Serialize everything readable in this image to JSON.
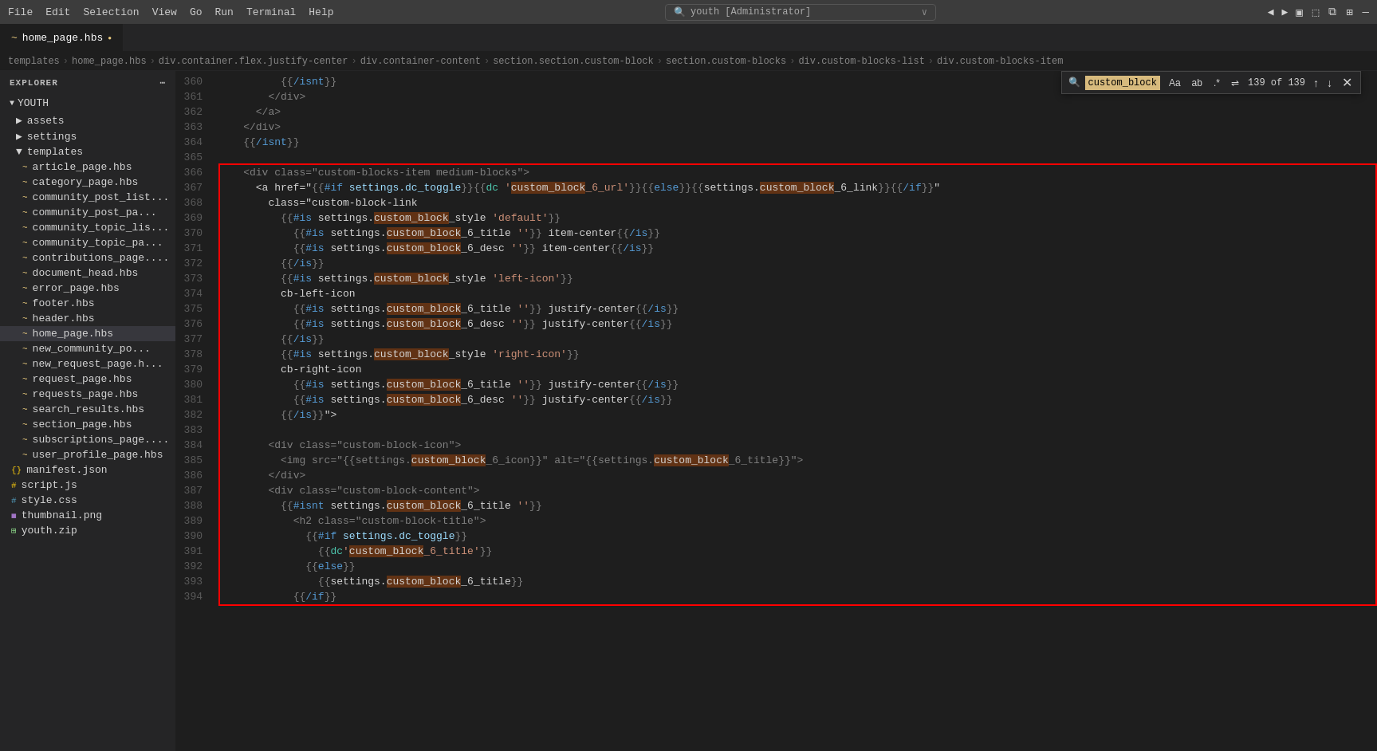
{
  "titlebar": {
    "menu": [
      "File",
      "Edit",
      "Selection",
      "View",
      "Go",
      "Run",
      "Terminal",
      "Help"
    ],
    "search_placeholder": "youth [Administrator]",
    "nav_back": "◀",
    "nav_fwd": "▶"
  },
  "tab": {
    "icon": "~",
    "filename": "home_page.hbs",
    "modified": true,
    "dot": "●"
  },
  "breadcrumb": {
    "items": [
      "templates",
      "home_page.hbs",
      "div.container.flex.justify-center",
      "div.container-content",
      "section.section.custom-block",
      "section.custom-blocks",
      "div.custom-blocks-list",
      "div.custom-blocks-item"
    ]
  },
  "sidebar": {
    "header": "EXPLORER",
    "root": "YOUTH",
    "sections": [
      {
        "label": "assets",
        "expanded": false
      },
      {
        "label": "settings",
        "expanded": false
      },
      {
        "label": "templates",
        "expanded": true
      }
    ],
    "files": [
      {
        "name": "article_page.hbs",
        "type": "hbs"
      },
      {
        "name": "category_page.hbs",
        "type": "hbs"
      },
      {
        "name": "community_post_list...",
        "type": "hbs"
      },
      {
        "name": "community_post_pa...",
        "type": "hbs"
      },
      {
        "name": "community_topic_lis...",
        "type": "hbs"
      },
      {
        "name": "community_topic_pa...",
        "type": "hbs"
      },
      {
        "name": "contributions_page....",
        "type": "hbs"
      },
      {
        "name": "document_head.hbs",
        "type": "hbs"
      },
      {
        "name": "error_page.hbs",
        "type": "hbs"
      },
      {
        "name": "footer.hbs",
        "type": "hbs"
      },
      {
        "name": "header.hbs",
        "type": "hbs"
      },
      {
        "name": "home_page.hbs",
        "type": "hbs",
        "active": true
      },
      {
        "name": "new_community_po...",
        "type": "hbs"
      },
      {
        "name": "new_request_page.h...",
        "type": "hbs"
      },
      {
        "name": "request_page.hbs",
        "type": "hbs"
      },
      {
        "name": "requests_page.hbs",
        "type": "hbs"
      },
      {
        "name": "search_results.hbs",
        "type": "hbs"
      },
      {
        "name": "section_page.hbs",
        "type": "hbs"
      },
      {
        "name": "subscriptions_page....",
        "type": "hbs"
      },
      {
        "name": "user_profile_page.hbs",
        "type": "hbs"
      }
    ],
    "root_files": [
      {
        "name": "manifest.json",
        "type": "json"
      },
      {
        "name": "script.js",
        "type": "js"
      },
      {
        "name": "style.css",
        "type": "css"
      },
      {
        "name": "thumbnail.png",
        "type": "png"
      },
      {
        "name": "youth.zip",
        "type": "zip"
      }
    ]
  },
  "find_widget": {
    "query": "custom_block",
    "options": [
      "Aa",
      "ab",
      ".*"
    ],
    "count": "139 of 139",
    "highlighted_text": "custom_block"
  },
  "code_lines": [
    {
      "num": 360,
      "content": "          {{/isnt}}"
    },
    {
      "num": 361,
      "content": "        </div>"
    },
    {
      "num": 362,
      "content": "      </a>"
    },
    {
      "num": 363,
      "content": "    </div>"
    },
    {
      "num": 364,
      "content": "    {{/isnt}}"
    },
    {
      "num": 365,
      "content": ""
    },
    {
      "num": 366,
      "content": "    <div class=\"custom-blocks-item medium-blocks\">",
      "highlight_start": true
    },
    {
      "num": 367,
      "content": "      <a href=\"{{#if settings.dc_toggle}}{{dc 'custom_block_6_url'}}{{else}}{{settings.custom_block_6_link}}{{/if}}\""
    },
    {
      "num": 368,
      "content": "        class=\"custom-block-link"
    },
    {
      "num": 369,
      "content": "          {{#is settings.custom_block_style 'default'}}"
    },
    {
      "num": 370,
      "content": "            {{#is settings.custom_block_6_title ''}} item-center{{/is}}"
    },
    {
      "num": 371,
      "content": "            {{#is settings.custom_block_6_desc ''}} item-center{{/is}}"
    },
    {
      "num": 372,
      "content": "          {{/is}}"
    },
    {
      "num": 373,
      "content": "          {{#is settings.custom_block_style 'left-icon'}}"
    },
    {
      "num": 374,
      "content": "          cb-left-icon"
    },
    {
      "num": 375,
      "content": "            {{#is settings.custom_block_6_title ''}} justify-center{{/is}}"
    },
    {
      "num": 376,
      "content": "            {{#is settings.custom_block_6_desc ''}} justify-center{{/is}}"
    },
    {
      "num": 377,
      "content": "          {{/is}}"
    },
    {
      "num": 378,
      "content": "          {{#is settings.custom_block_style 'right-icon'}}"
    },
    {
      "num": 379,
      "content": "          cb-right-icon"
    },
    {
      "num": 380,
      "content": "            {{#is settings.custom_block_6_title ''}} justify-center{{/is}}"
    },
    {
      "num": 381,
      "content": "            {{#is settings.custom_block_6_desc ''}} justify-center{{/is}}"
    },
    {
      "num": 382,
      "content": "          {{/is}}\">"
    },
    {
      "num": 383,
      "content": ""
    },
    {
      "num": 384,
      "content": "        <div class=\"custom-block-icon\">"
    },
    {
      "num": 385,
      "content": "          <img src=\"{{settings.custom_block_6_icon}}\" alt=\"{{settings.custom_block_6_title}}\">"
    },
    {
      "num": 386,
      "content": "        </div>"
    },
    {
      "num": 387,
      "content": "        <div class=\"custom-block-content\">"
    },
    {
      "num": 388,
      "content": "          {{#isnt settings.custom_block_6_title ''}}"
    },
    {
      "num": 389,
      "content": "            <h2 class=\"custom-block-title\">"
    },
    {
      "num": 390,
      "content": "              {{#if settings.dc_toggle}}"
    },
    {
      "num": 391,
      "content": "                {{dc'custom_block_6_title'}}"
    },
    {
      "num": 392,
      "content": "              {{else}}"
    },
    {
      "num": 393,
      "content": "                {{settings.custom_block_6_title}}"
    },
    {
      "num": 394,
      "content": "            {{/if}}"
    }
  ]
}
